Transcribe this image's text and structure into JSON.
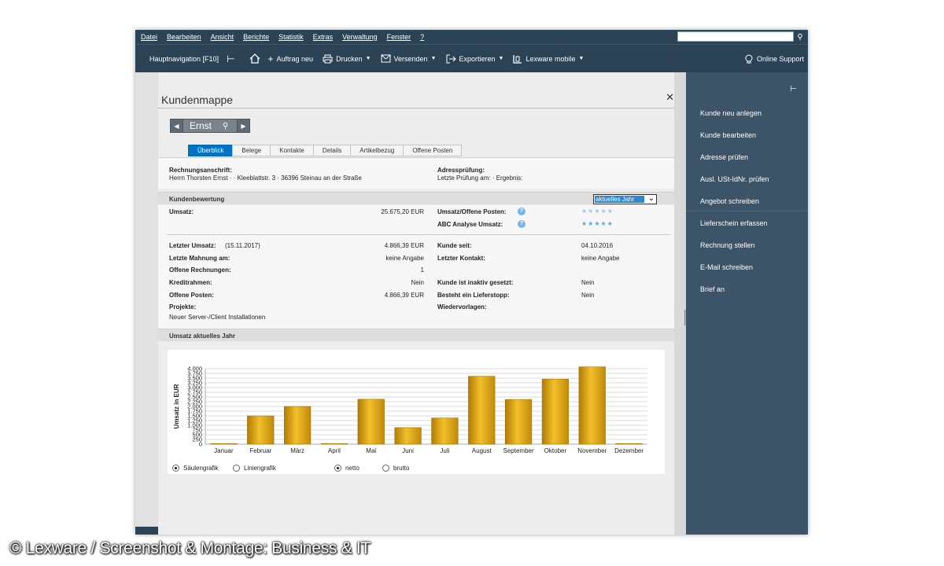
{
  "menu": [
    "Datei",
    "Bearbeiten",
    "Ansicht",
    "Berichte",
    "Statistik",
    "Extras",
    "Verwaltung",
    "Fenster",
    "?"
  ],
  "toolbar": {
    "hauptnavigation": "Hauptnavigation [F10]",
    "auftrag_neu": "Auftrag neu",
    "drucken": "Drucken",
    "versenden": "Versenden",
    "exportieren": "Exportieren",
    "lexware_mobile": "Lexware mobile",
    "online_support": "Online Support"
  },
  "sidebar": {
    "items": [
      "Kunde neu anlegen",
      "Kunde bearbeiten",
      "Adresse prüfen",
      "Ausl. USt-IdNr. prüfen",
      "Angebot schreiben",
      "Lieferschein erfassen",
      "Rechnung stellen",
      "E-Mail schreiben",
      "Brief an"
    ]
  },
  "document": {
    "title": "Kundenmappe",
    "customer_name": "Ernst",
    "tabs": [
      "Überblick",
      "Belege",
      "Kontakte",
      "Details",
      "Artikelbezug",
      "Offene Posten"
    ],
    "active_tab": "Überblick"
  },
  "address": {
    "label": "Rechnungsanschrift:",
    "value": "Herrn Thorsten Ernst · · Kleeblattstr. 3 · 36396 Steinau an der Straße",
    "check_label": "Adressprüfung:",
    "check_value": "Letzte Prüfung am: · Ergebnis:"
  },
  "rating": {
    "header": "Kundenbewertung",
    "period": "aktuelles Jahr",
    "umsatz_label": "Umsatz:",
    "umsatz_value": "25.675,20 EUR",
    "offene_label": "Umsatz/Offene Posten:",
    "abc_label": "ABC Analyse Umsatz:",
    "offene_stars": "★★★★★",
    "abc_stars": "★★★★★"
  },
  "details": {
    "letzter_umsatz_label": "Letzter Umsatz:",
    "letzter_umsatz_date": "(15.11.2017)",
    "letzter_umsatz_value": "4.866,39 EUR",
    "mahnung_label": "Letzte Mahnung am:",
    "mahnung_value": "keine Angabe",
    "offene_rechnungen_label": "Offene Rechnungen:",
    "offene_rechnungen_value": "1",
    "kreditrahmen_label": "Kreditrahmen:",
    "kreditrahmen_value": "Nein",
    "offene_posten_label": "Offene Posten:",
    "offene_posten_value": "4.866,39 EUR",
    "projekte_label": "Projekte:",
    "projekte_value": "Neuer Server-/Client Installationen",
    "kunde_seit_label": "Kunde seit:",
    "kunde_seit_value": "04.10.2016",
    "letzter_kontakt_label": "Letzter Kontakt:",
    "letzter_kontakt_value": "keine Angabe",
    "inaktiv_label": "Kunde ist inaktiv gesetzt:",
    "inaktiv_value": "Nein",
    "lieferstopp_label": "Besteht ein Lieferstopp:",
    "lieferstopp_value": "Nein",
    "wiedervorlagen_label": "Wiedervorlagen:"
  },
  "chart_section": {
    "header": "Umsatz aktuelles Jahr",
    "radio_saeulen": "Säulengrafik",
    "radio_linien": "Liniengrafik",
    "radio_netto": "netto",
    "radio_brutto": "brutto"
  },
  "chart_data": {
    "type": "bar",
    "categories": [
      "Januar",
      "Februar",
      "März",
      "April",
      "Mai",
      "Juni",
      "Juli",
      "August",
      "September",
      "Oktober",
      "November",
      "Dezember"
    ],
    "values": [
      0,
      1500,
      2000,
      0,
      2380,
      880,
      1390,
      3600,
      2370,
      3450,
      4100,
      0
    ],
    "ylabel": "Umsatz in EUR",
    "ylim": [
      0,
      4000
    ],
    "yticks": [
      "0",
      "250",
      "500",
      "750",
      "1.000",
      "1.250",
      "1.500",
      "1.750",
      "2.000",
      "2.250",
      "2.500",
      "2.750",
      "3.000",
      "3.250",
      "3.500",
      "3.750",
      "4.000"
    ],
    "grid": true,
    "bar_color": "#e3a812"
  },
  "caption": "© Lexware / Screenshot & Montage: Business & IT"
}
